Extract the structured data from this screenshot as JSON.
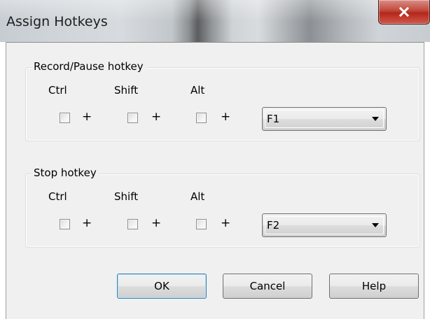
{
  "window": {
    "title": "Assign Hotkeys",
    "close_glyph": "x"
  },
  "record_group": {
    "label": "Record/Pause hotkey",
    "ctrl_label": "Ctrl",
    "shift_label": "Shift",
    "alt_label": "Alt",
    "ctrl_checked": false,
    "shift_checked": false,
    "alt_checked": false,
    "plus": "+",
    "key_value": "F1"
  },
  "stop_group": {
    "label": "Stop hotkey",
    "ctrl_label": "Ctrl",
    "shift_label": "Shift",
    "alt_label": "Alt",
    "ctrl_checked": false,
    "shift_checked": false,
    "alt_checked": false,
    "plus": "+",
    "key_value": "F2"
  },
  "buttons": {
    "ok": "OK",
    "cancel": "Cancel",
    "help": "Help"
  }
}
